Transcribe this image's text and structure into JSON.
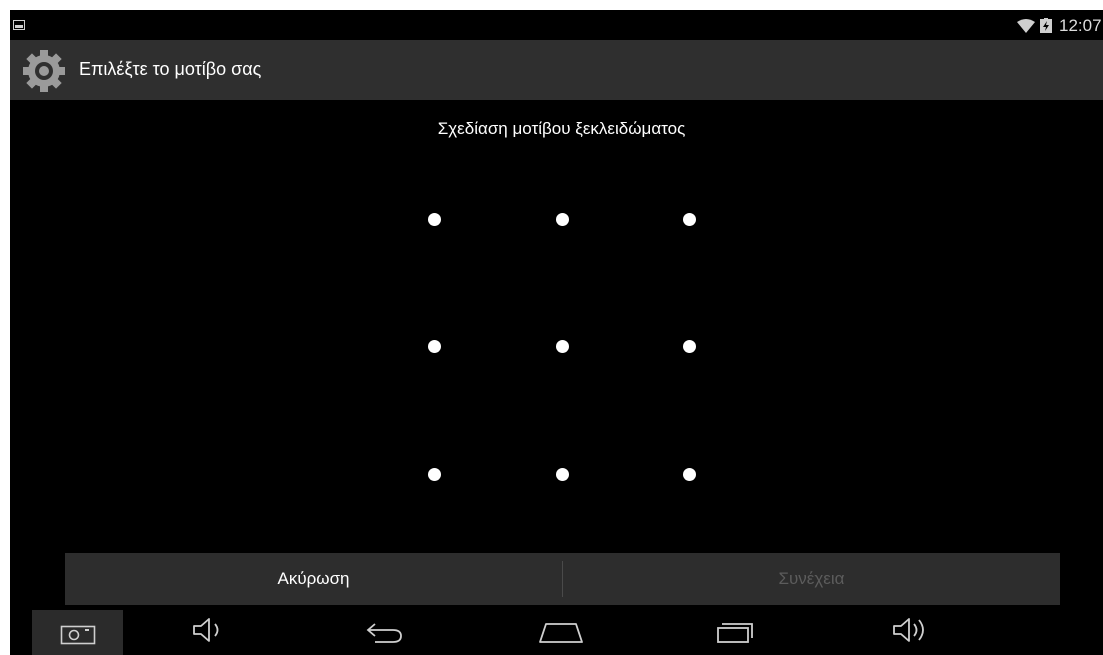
{
  "status_bar": {
    "time": "12:07",
    "icons": [
      "image-notification-icon",
      "wifi-icon",
      "battery-charging-icon"
    ]
  },
  "action_bar": {
    "title": "Επιλέξτε το μοτίβο σας",
    "icon": "gear-icon"
  },
  "pattern": {
    "instruction": "Σχεδίαση μοτίβου ξεκλειδώματος",
    "rows": 3,
    "cols": 3
  },
  "buttons": {
    "cancel_label": "Ακύρωση",
    "continue_label": "Συνέχεια"
  },
  "nav_bar": {
    "icons": [
      "screenshot-icon",
      "volume-down-icon",
      "back-icon",
      "home-icon",
      "recent-apps-icon",
      "volume-up-icon"
    ]
  },
  "colors": {
    "background": "#000000",
    "action_bar": "#2f2f2f",
    "button_bar": "#2d2d2d",
    "disabled_text": "#5c5c5c"
  }
}
